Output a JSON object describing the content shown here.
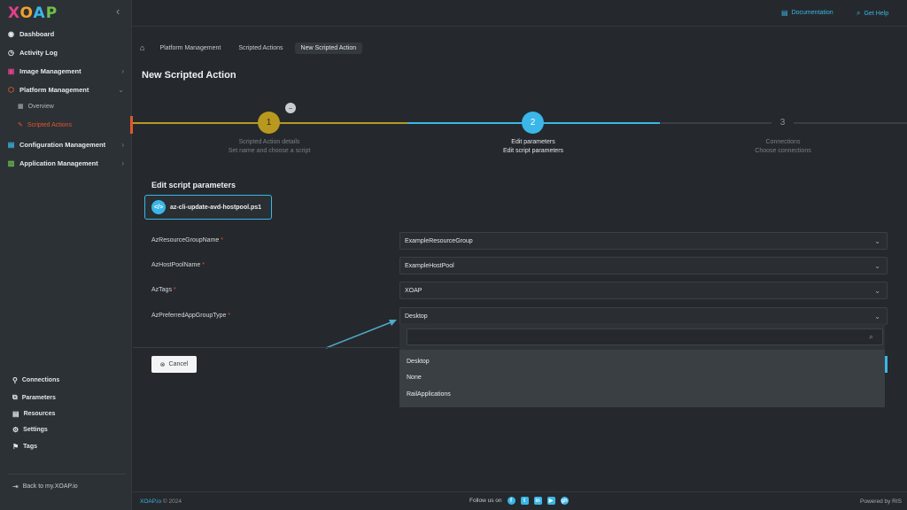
{
  "sidebar": {
    "logo": [
      "X",
      "O",
      "A",
      "P"
    ],
    "collapse_icon": "chevron-left-icon",
    "items": [
      {
        "label": "Dashboard",
        "icon": "dashboard-icon"
      },
      {
        "label": "Activity Log",
        "icon": "activity-icon"
      },
      {
        "label": "Image Management",
        "icon": "image-icon"
      },
      {
        "label": "Platform Management",
        "icon": "platform-icon"
      },
      {
        "label": "Configuration Management",
        "icon": "configuration-icon"
      },
      {
        "label": "Application Management",
        "icon": "application-icon"
      }
    ],
    "sub_items": [
      {
        "label": "Overview",
        "icon": "grid-icon"
      },
      {
        "label": "Scripted Actions",
        "icon": "script-icon"
      }
    ],
    "bottom_items": [
      {
        "label": "Connections",
        "icon": "link-icon"
      },
      {
        "label": "Parameters",
        "icon": "parameters-icon"
      },
      {
        "label": "Resources",
        "icon": "resources-icon"
      },
      {
        "label": "Settings",
        "icon": "gear-icon"
      },
      {
        "label": "Tags",
        "icon": "tag-icon"
      }
    ],
    "back_link": "Back to my.XOAP.io",
    "accent_color": "#e2572a"
  },
  "topbar": {
    "documentation": "Documentation",
    "help": "Get Help"
  },
  "breadcrumb": [
    "Platform Management",
    "Scripted Actions",
    "New Scripted Action"
  ],
  "page_title": "New Scripted Action",
  "steps": [
    {
      "number": "1",
      "title": "Scripted Action details",
      "subtitle": "Set name and choose a script",
      "state": "completed",
      "color": "#b8981e"
    },
    {
      "number": "2",
      "title": "Edit parameters",
      "subtitle": "Edit script parameters",
      "state": "active",
      "color": "#3ab6e8"
    },
    {
      "number": "3",
      "title": "Connections",
      "subtitle": "Choose connections",
      "state": "pending",
      "color": "#5c6268"
    }
  ],
  "form": {
    "section_title": "Edit script parameters",
    "script_name": "az-cli-update-avd-hostpool.ps1",
    "script_icon": "code-icon",
    "params": [
      {
        "label": "AzResourceGroupName",
        "required": "*",
        "value": "ExampleResourceGroup"
      },
      {
        "label": "AzHostPoolName",
        "required": "*",
        "value": "ExampleHostPool"
      },
      {
        "label": "AzTags",
        "required": "*",
        "value": "XOAP"
      },
      {
        "label": "AzPreferredAppGroupType",
        "required": "*",
        "value": "Desktop"
      }
    ],
    "cancel_label": "Cancel"
  },
  "dropdown": {
    "search_value": "",
    "options": [
      "Desktop",
      "None",
      "RailApplications"
    ]
  },
  "footer": {
    "brand": "XOAP.io",
    "copyright": " © 2024",
    "follow": "Follow us on",
    "social": [
      "f",
      "t",
      "in",
      "▶",
      "gh"
    ],
    "powered": "Powered by RIS"
  }
}
